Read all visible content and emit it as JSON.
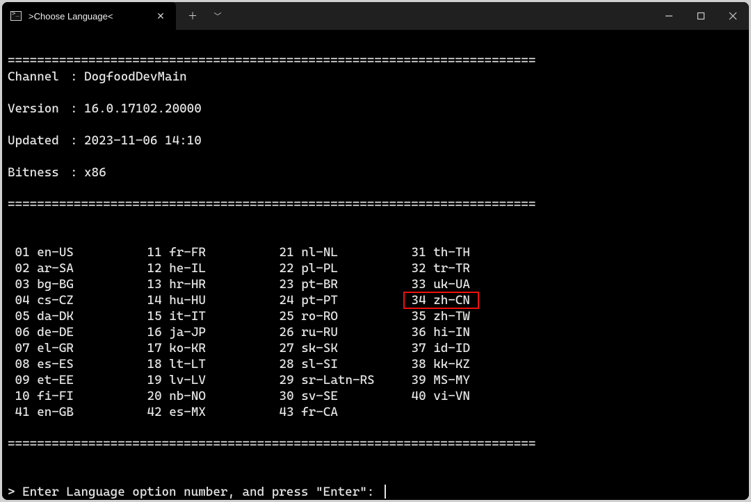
{
  "window": {
    "tab_title": ">Choose Language<"
  },
  "header": {
    "channel_label": "Channel",
    "channel": "DogfoodDevMain",
    "version_label": "Version",
    "version": "16.0.17102.20000",
    "updated_label": "Updated",
    "updated": "2023-11-06 14:10",
    "bitness_label": "Bitness",
    "bitness": "x86",
    "rule": "========================================================================"
  },
  "langs": {
    "col1": [
      "01 en-US",
      "02 ar-SA",
      "03 bg-BG",
      "04 cs-CZ",
      "05 da-DK",
      "06 de-DE",
      "07 el-GR",
      "08 es-ES",
      "09 et-EE",
      "10 fi-FI",
      "41 en-GB"
    ],
    "col2": [
      "11 fr-FR",
      "12 he-IL",
      "13 hr-HR",
      "14 hu-HU",
      "15 it-IT",
      "16 ja-JP",
      "17 ko-KR",
      "18 lt-LT",
      "19 lv-LV",
      "20 nb-NO",
      "42 es-MX"
    ],
    "col3": [
      "21 nl-NL",
      "22 pl-PL",
      "23 pt-BR",
      "24 pt-PT",
      "25 ro-RO",
      "26 ru-RU",
      "27 sk-SK",
      "28 sl-SI",
      "29 sr-Latn-RS",
      "30 sv-SE",
      "43 fr-CA"
    ],
    "col4": [
      "31 th-TH",
      "32 tr-TR",
      "33 uk-UA",
      "34 zh-CN",
      "35 zh-TW",
      "36 hi-IN",
      "37 id-ID",
      "38 kk-KZ",
      "39 MS-MY",
      "40 vi-VN",
      ""
    ]
  },
  "highlight_value": "34 zh-CN",
  "prompt": "> Enter Language option number, and press \"Enter\": "
}
